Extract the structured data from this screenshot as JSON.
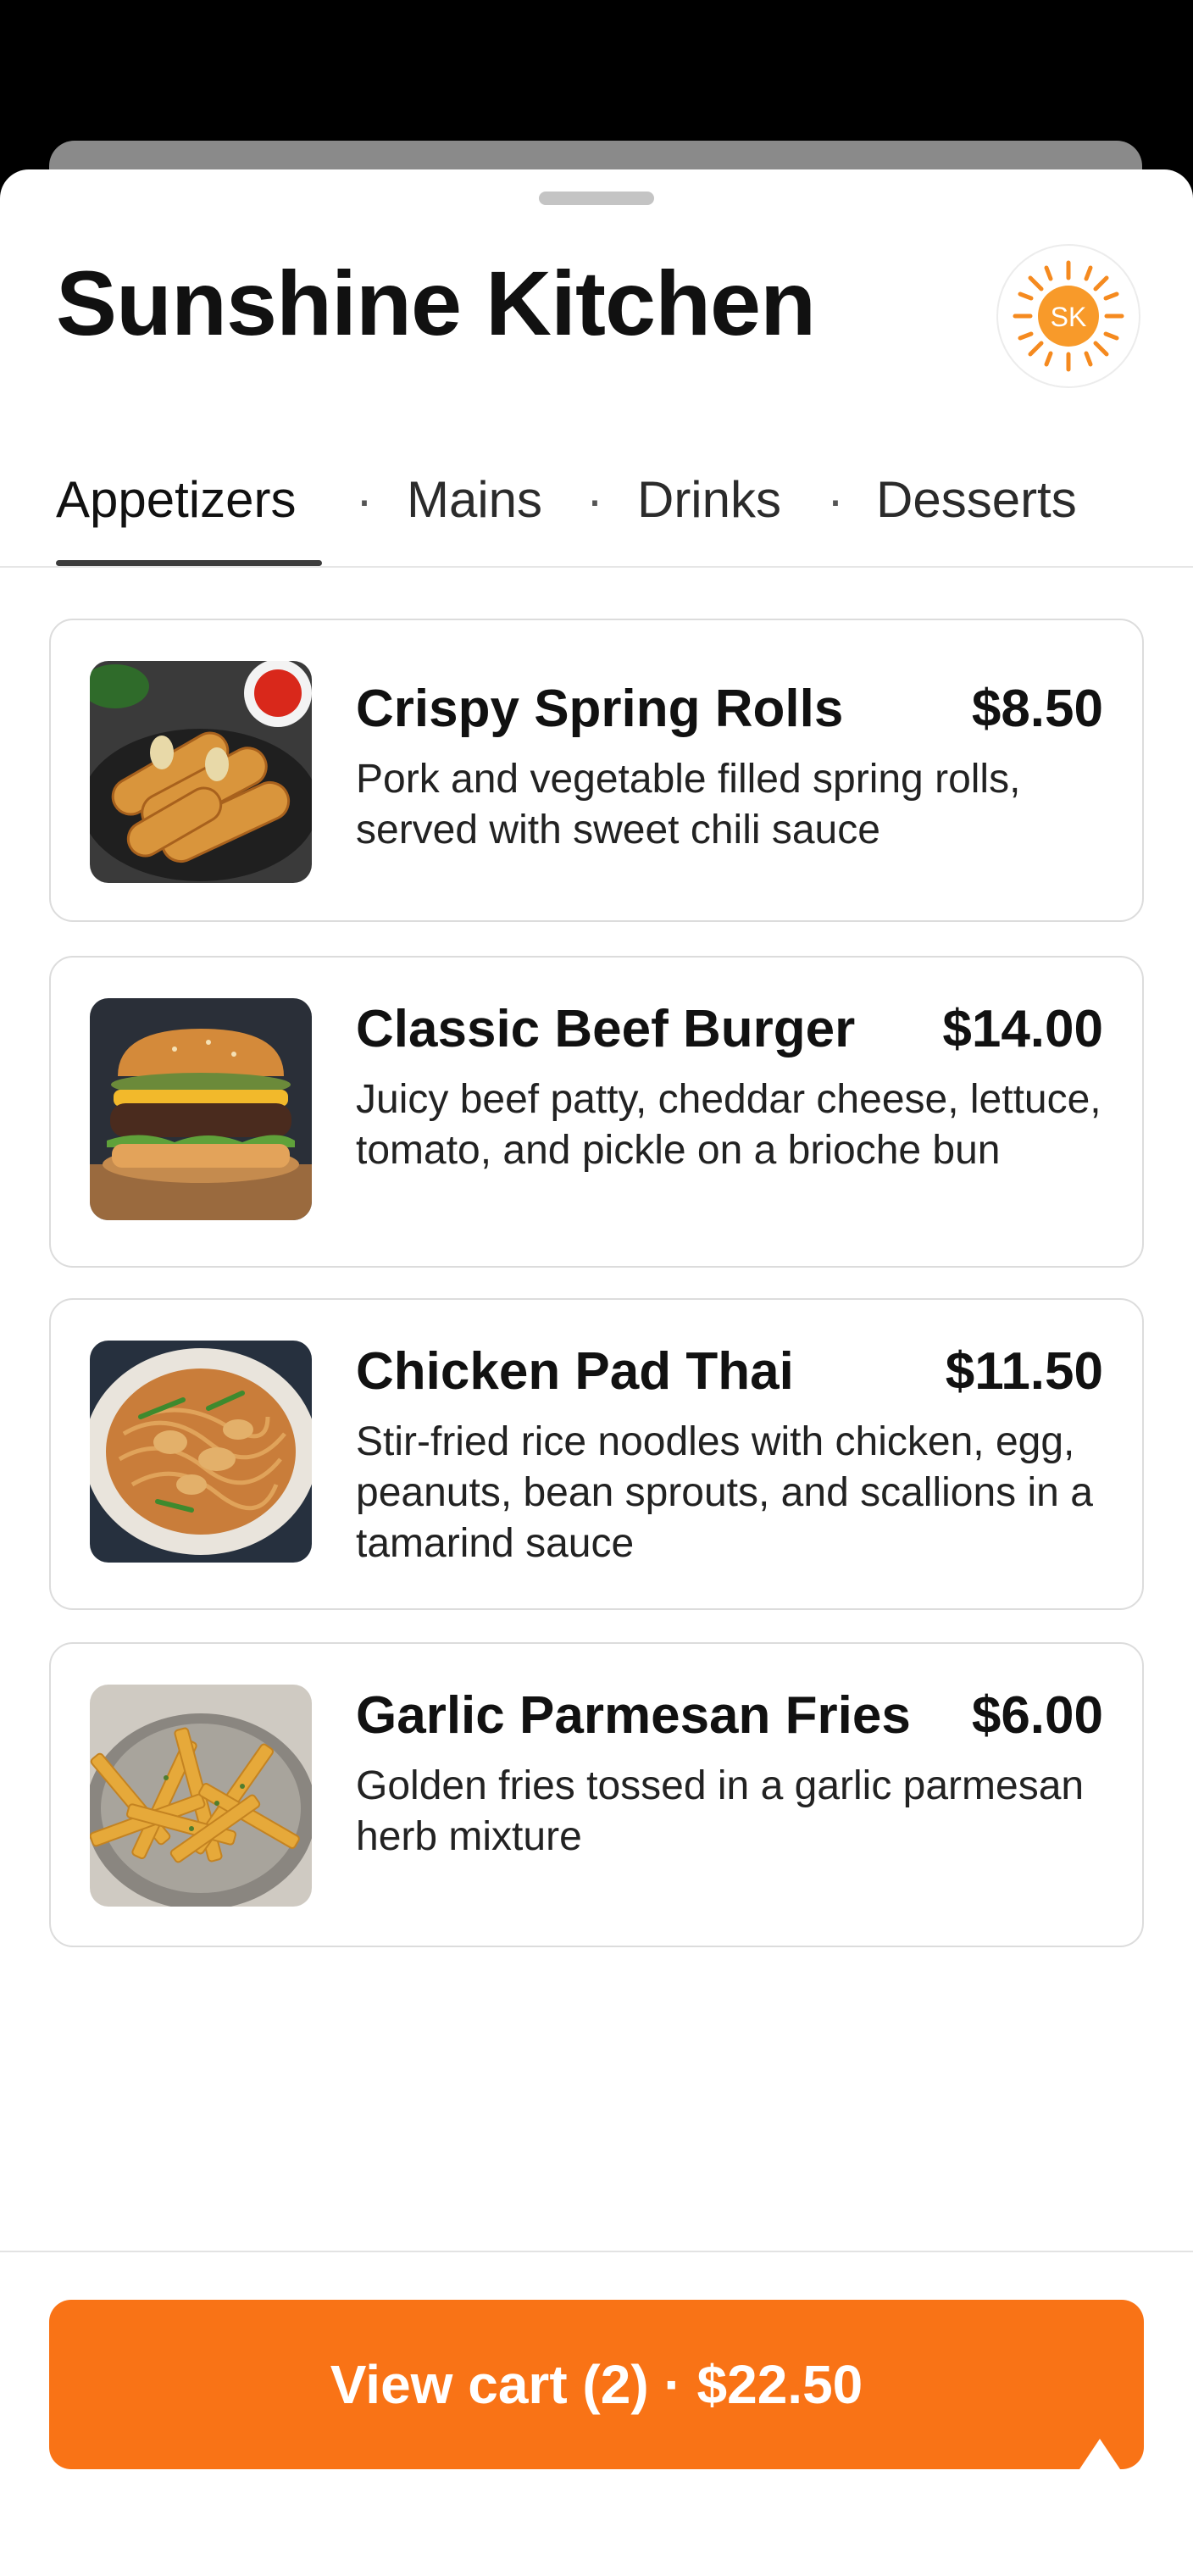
{
  "restaurant": {
    "name": "Sunshine Kitchen",
    "logo_initials": "SK",
    "logo_icon": "sun-icon",
    "logo_color": "#f58a1f"
  },
  "tabs": [
    {
      "label": "Appetizers",
      "active": true
    },
    {
      "label": "Mains",
      "active": false
    },
    {
      "label": "Drinks",
      "active": false
    },
    {
      "label": "Desserts",
      "active": false
    }
  ],
  "tab_separator": "·",
  "menu_items": [
    {
      "name": "Crispy Spring Rolls",
      "price": "$8.50",
      "description": "Pork and vegetable filled spring rolls, served with sweet chili sauce",
      "image_icon": "spring-rolls-photo"
    },
    {
      "name": "Classic Beef Burger",
      "price": "$14.00",
      "description": "Juicy beef patty, cheddar cheese, lettuce, tomato, and pickle on a brioche bun",
      "image_icon": "burger-photo"
    },
    {
      "name": "Chicken Pad Thai",
      "price": "$11.50",
      "description": "Stir-fried rice noodles with chicken, egg, peanuts, bean sprouts, and scallions in a tamarind sauce",
      "image_icon": "pad-thai-photo"
    },
    {
      "name": "Garlic Parmesan Fries",
      "price": "$6.00",
      "description": "Golden fries tossed in a garlic parmesan herb mixture",
      "image_icon": "fries-photo"
    }
  ],
  "cart": {
    "label": "View cart (2) · $22.50",
    "color": "#f97316"
  }
}
